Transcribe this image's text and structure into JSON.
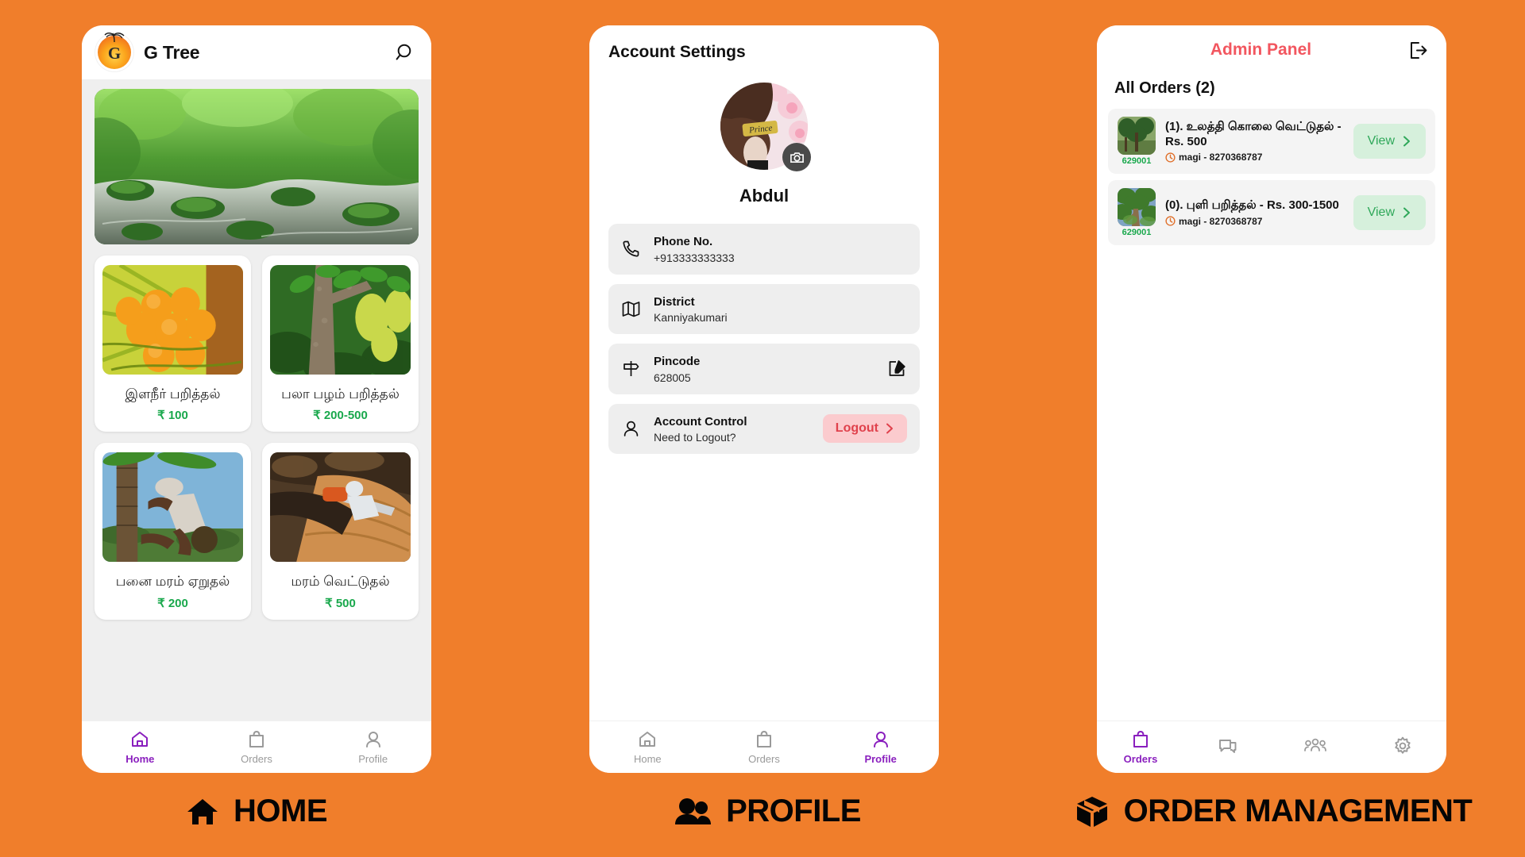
{
  "theme": {
    "background": "#F07E2B",
    "accent_purple": "#8A1FBE",
    "price_green": "#19a84c",
    "admin_red": "#F2565F",
    "logout_pink_bg": "#FBCBCE",
    "logout_text": "#E0414C",
    "view_green_bg": "#D6F0DC",
    "view_green_text": "#2fa85a"
  },
  "home": {
    "app_title": "G Tree",
    "logo_letter": "G",
    "search_icon": "search-icon",
    "products": [
      {
        "name": "இளநீர் பறித்தல்",
        "price": "₹ 100"
      },
      {
        "name": "பலா பழம் பறித்தல்",
        "price": "₹ 200-500"
      },
      {
        "name": "பனை மரம் ஏறுதல்",
        "price": "₹ 200"
      },
      {
        "name": "மரம் வெட்டுதல்",
        "price": "₹ 500"
      }
    ],
    "nav": [
      {
        "label": "Home",
        "icon": "home-icon",
        "active": true
      },
      {
        "label": "Orders",
        "icon": "bag-icon",
        "active": false
      },
      {
        "label": "Profile",
        "icon": "person-icon",
        "active": false
      }
    ]
  },
  "profile": {
    "title": "Account Settings",
    "name": "Abdul",
    "camera_icon": "camera-icon",
    "rows": [
      {
        "icon": "phone-icon",
        "label": "Phone No.",
        "value": "+913333333333",
        "action": ""
      },
      {
        "icon": "map-icon",
        "label": "District",
        "value": "Kanniyakumari",
        "action": ""
      },
      {
        "icon": "signpost-icon",
        "label": "Pincode",
        "value": "628005",
        "action": "edit-icon"
      },
      {
        "icon": "person-icon",
        "label": "Account Control",
        "value": "Need to Logout?",
        "action": "logout-button"
      }
    ],
    "logout_label": "Logout",
    "nav": [
      {
        "label": "Home",
        "icon": "home-icon",
        "active": false
      },
      {
        "label": "Orders",
        "icon": "bag-icon",
        "active": false
      },
      {
        "label": "Profile",
        "icon": "person-icon",
        "active": true
      }
    ]
  },
  "admin": {
    "title": "Admin Panel",
    "logout_icon": "logout-icon",
    "orders_heading": "All Orders (2)",
    "view_label": "View",
    "orders": [
      {
        "pincode": "629001",
        "title": "(1). உலத்தி கொலை வெட்டுதல்  - Rs. 500",
        "customer": "magi - 8270368787",
        "clock_icon": "clock-icon"
      },
      {
        "pincode": "629001",
        "title": "(0). புளி பறித்தல் - Rs. 300-1500",
        "customer": "magi - 8270368787",
        "clock_icon": "clock-icon"
      }
    ],
    "nav": [
      {
        "label": "Orders",
        "icon": "bag-icon",
        "active": true
      },
      {
        "label": "",
        "icon": "chat-icon",
        "active": false
      },
      {
        "label": "",
        "icon": "people-icon",
        "active": false
      },
      {
        "label": "",
        "icon": "gear-icon",
        "active": false
      }
    ]
  },
  "captions": [
    {
      "label": "HOME",
      "icon": "home-solid-icon"
    },
    {
      "label": "PROFILE",
      "icon": "people-solid-icon"
    },
    {
      "label": "ORDER MANAGEMENT",
      "icon": "box-solid-icon"
    }
  ]
}
